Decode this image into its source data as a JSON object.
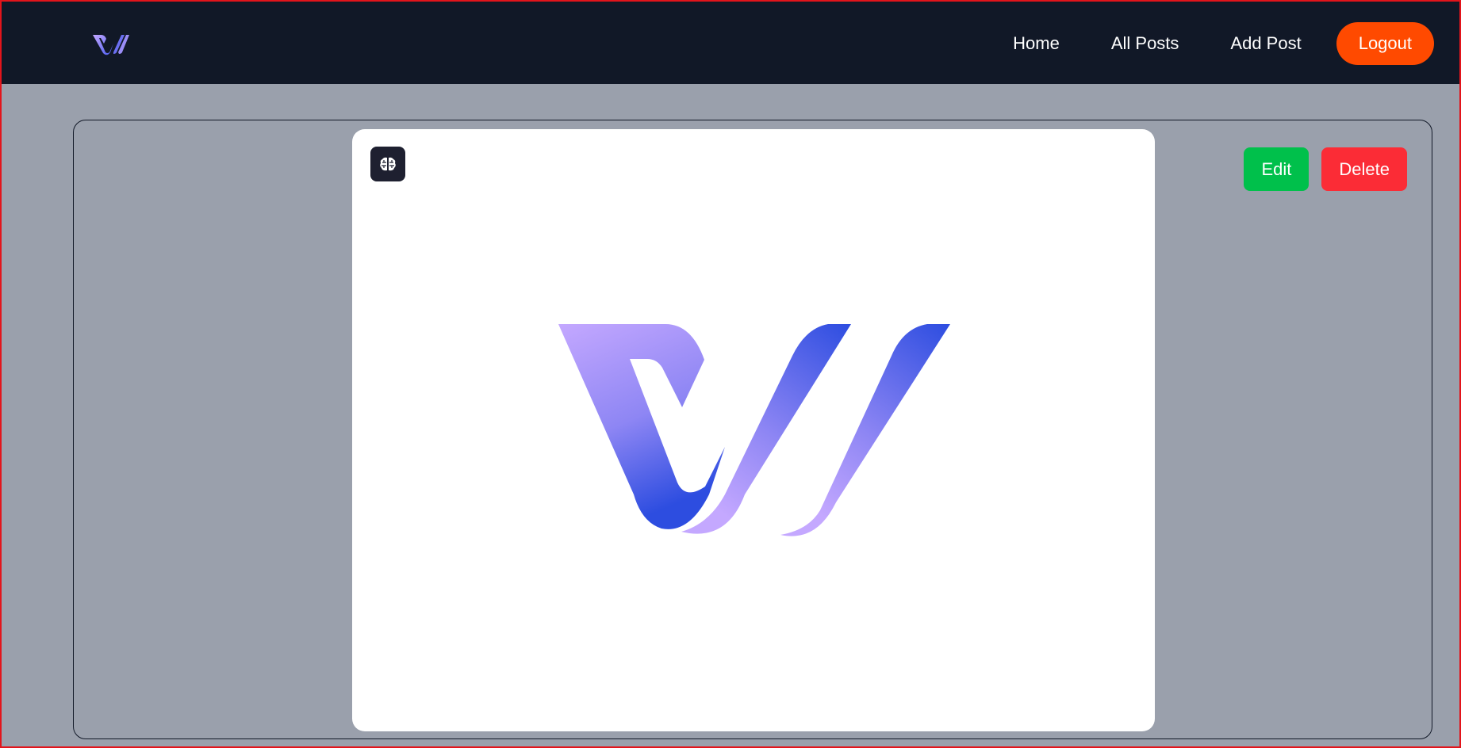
{
  "header": {
    "logo_icon": "brand-logo-icon",
    "nav": {
      "home": "Home",
      "all_posts": "All Posts",
      "add_post": "Add Post"
    },
    "logout_label": "Logout"
  },
  "post": {
    "image_icon": "brain-icon",
    "actions": {
      "edit_label": "Edit",
      "delete_label": "Delete"
    }
  },
  "colors": {
    "header_bg": "#111827",
    "page_bg": "#9aa0ac",
    "logout": "#ff4a00",
    "edit": "#00c04b",
    "delete": "#fb2c36",
    "logo_light": "#c4a8ff",
    "logo_dark": "#2d4de0"
  }
}
